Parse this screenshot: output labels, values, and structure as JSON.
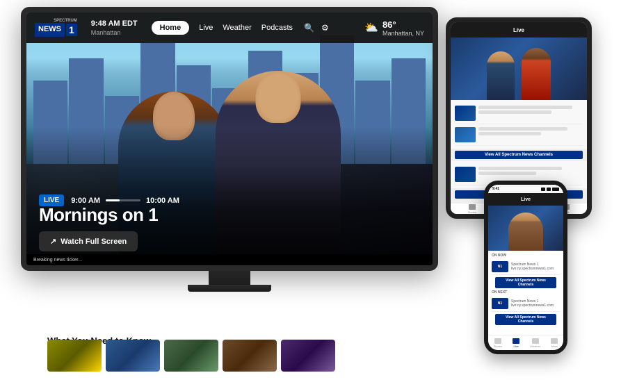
{
  "app": {
    "title": "Spectrum News 1"
  },
  "tv": {
    "navbar": {
      "logo_spectrum": "SPECTRUM",
      "logo_news": "NEWS",
      "logo_number": "1",
      "time": "9:48 AM EDT",
      "location": "Manhattan",
      "nav_home": "Home",
      "nav_live": "Live",
      "nav_weather": "Weather",
      "nav_podcasts": "Podcasts"
    },
    "weather": {
      "icon": "☁",
      "temp": "86°",
      "location": "Manhattan, NY"
    },
    "broadcast": {
      "live_badge": "LIVE",
      "time_start": "9:00 AM",
      "time_end": "10:00 AM",
      "show_title": "Mornings on 1"
    },
    "watch_button": "Watch Full Screen",
    "section_label": "What You Need to Know"
  },
  "tablet": {
    "nav_label": "Live",
    "view_all_btn": "View All Spectrum News Channels"
  },
  "phone": {
    "time": "9:41",
    "nav_label": "Live",
    "on_now_label": "ON NOW",
    "on_next_label": "ON NEXT",
    "channel_name": "Spectrum News 1",
    "channel_url": "live.ny.spectrumnews1.com",
    "view_all_btn": "View All Spectrum News Channels",
    "tabs": [
      "Stories",
      "Live",
      "Weather",
      "More"
    ]
  }
}
